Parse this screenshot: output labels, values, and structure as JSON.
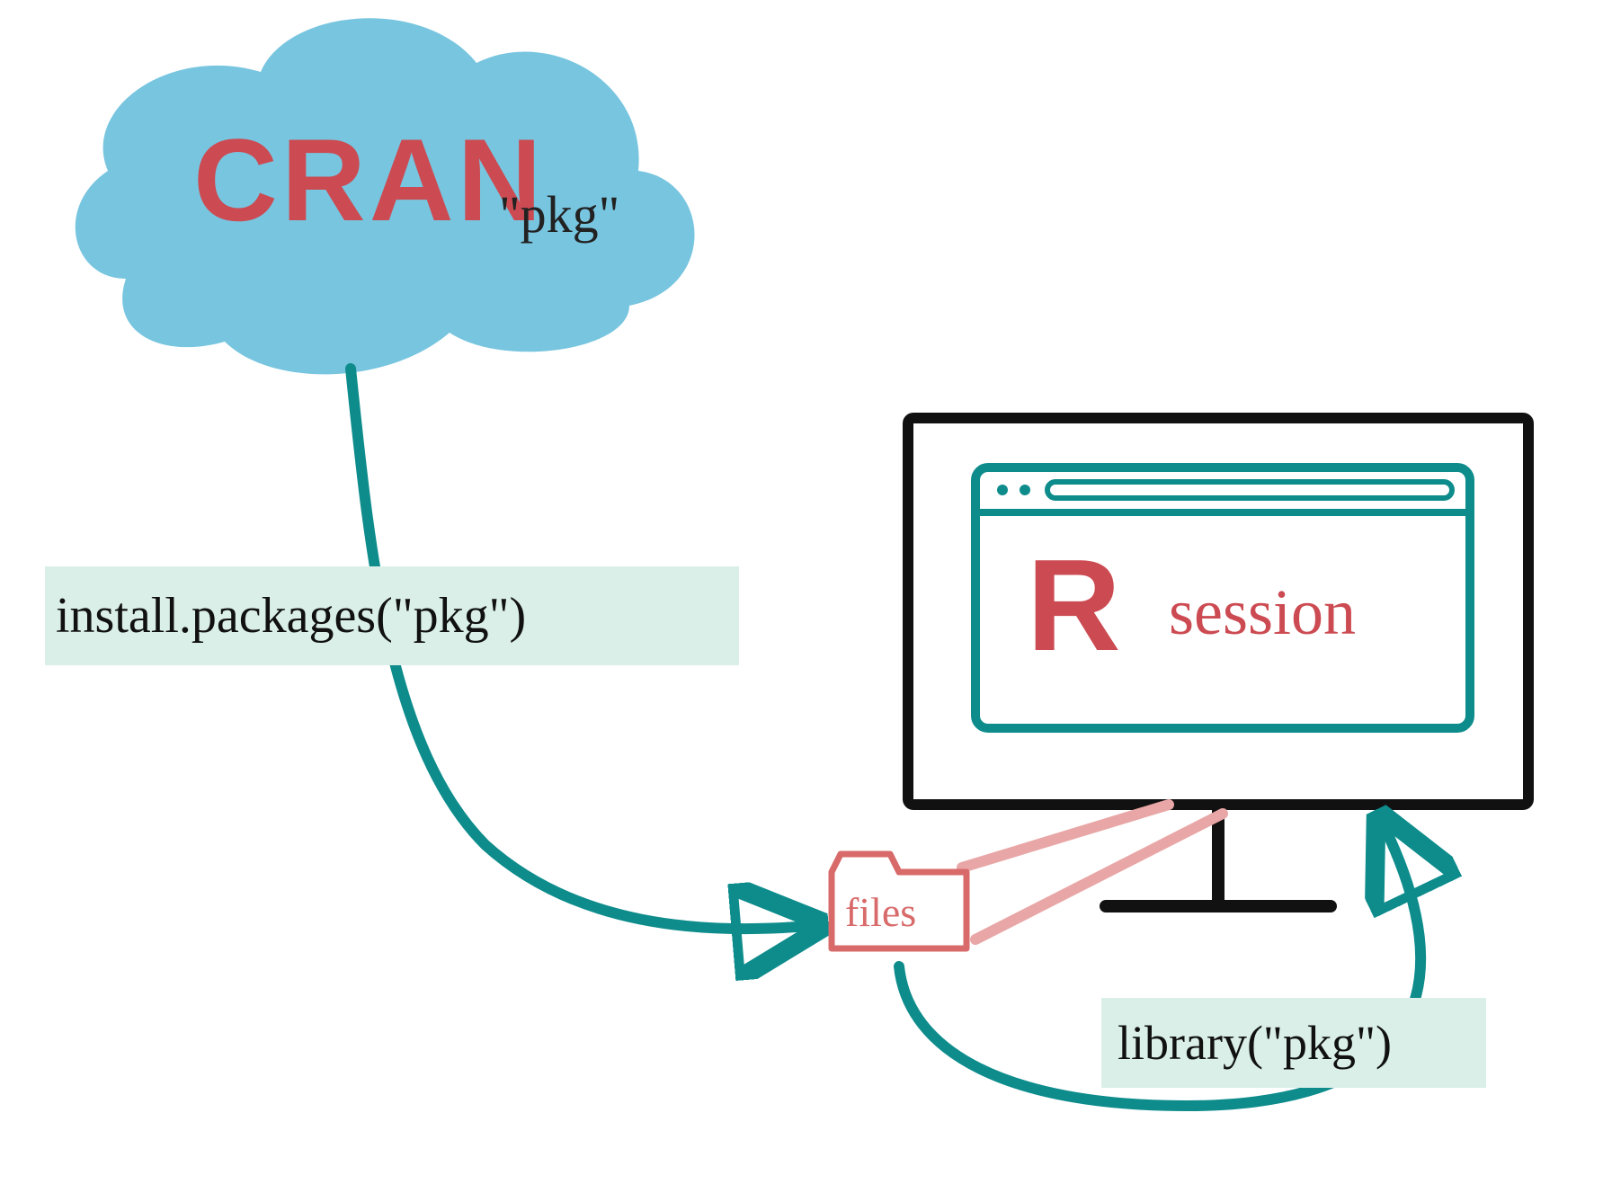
{
  "cloud": {
    "title": "CRAN",
    "pkg_label": "\"pkg\""
  },
  "commands": {
    "install": "install.packages(\"pkg\")",
    "library": "library(\"pkg\")"
  },
  "session": {
    "R": "R",
    "label": "session"
  },
  "folder": {
    "label": "files"
  },
  "colors": {
    "cloud": "#78c5e0",
    "accent_red": "#cc4b52",
    "teal": "#0e8c8c",
    "mint": "#d9efe7",
    "pink": "#e9a6a6",
    "black": "#111111"
  }
}
